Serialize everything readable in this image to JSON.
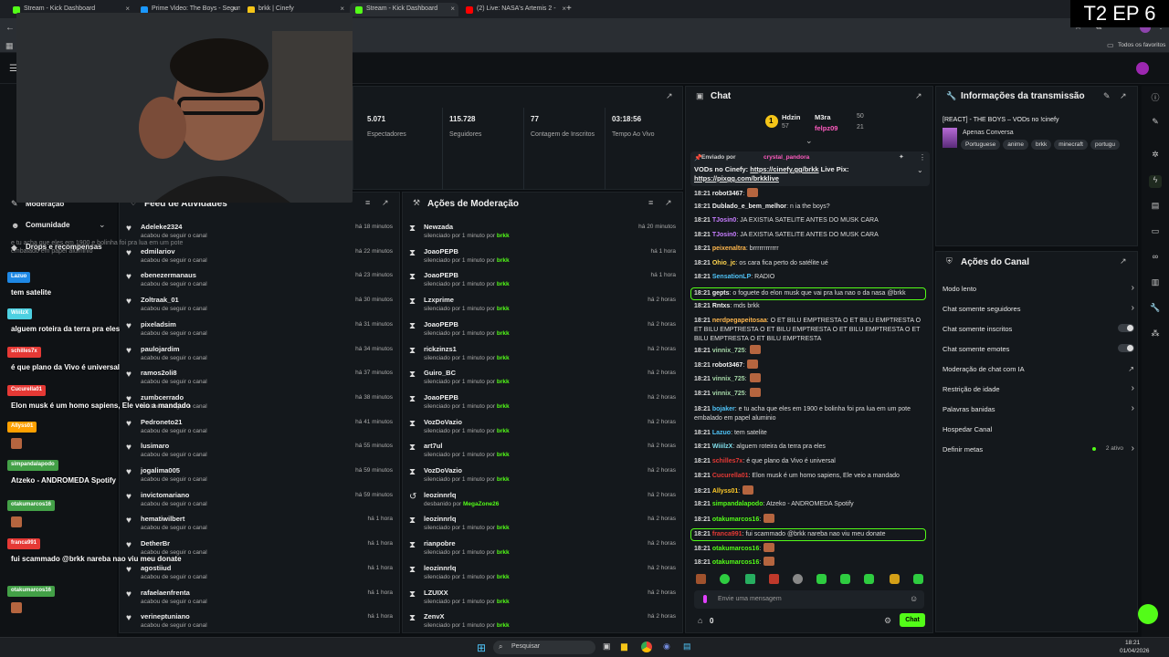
{
  "overlay_label": "T2 EP 6",
  "browser": {
    "tabs": [
      {
        "title": "Stream - Kick Dashboard",
        "color": "#53fc18"
      },
      {
        "title": "Prime Video: The Boys - Segun",
        "color": "#1a98ff"
      },
      {
        "title": "brkk | Cinefy",
        "color": "#f5c518"
      },
      {
        "title": "Stream - Kick Dashboard",
        "color": "#53fc18"
      },
      {
        "title": "(2) Live: NASA's Artemis 2 - ",
        "color": "#ff0000"
      }
    ],
    "new_tab": "+",
    "bookmarks_label": "Todos os favoritos"
  },
  "sidebar": {
    "moderation": "Moderação",
    "community": "Comunidade",
    "drops": "Drops e recompensas"
  },
  "stats": [
    {
      "value": "5.071",
      "label": "Espectadores"
    },
    {
      "value": "115.728",
      "label": "Seguidores"
    },
    {
      "value": "77",
      "label": "Contagem de Inscritos"
    },
    {
      "value": "03:18:56",
      "label": "Tempo Ao Vivo"
    }
  ],
  "feed": {
    "title": "Feed de Atividades",
    "items": [
      {
        "name": "Adeleke2324",
        "sub": "acabou de seguir o canal",
        "time": "há 18 minutos"
      },
      {
        "name": "edmilariov",
        "sub": "acabou de seguir o canal",
        "time": "há 22 minutos"
      },
      {
        "name": "ebenezermanaus",
        "sub": "acabou de seguir o canal",
        "time": "há 23 minutos"
      },
      {
        "name": "Zoltraak_01",
        "sub": "acabou de seguir o canal",
        "time": "há 30 minutos"
      },
      {
        "name": "pixeladsim",
        "sub": "acabou de seguir o canal",
        "time": "há 31 minutos"
      },
      {
        "name": "paulojardim",
        "sub": "acabou de seguir o canal",
        "time": "há 34 minutos"
      },
      {
        "name": "ramos2oli8",
        "sub": "acabou de seguir o canal",
        "time": "há 37 minutos"
      },
      {
        "name": "zumbcerrado",
        "sub": "acabou de seguir o canal",
        "time": "há 38 minutos"
      },
      {
        "name": "Pedroneto21",
        "sub": "acabou de seguir o canal",
        "time": "há 41 minutos"
      },
      {
        "name": "lusimaro",
        "sub": "acabou de seguir o canal",
        "time": "há 55 minutos"
      },
      {
        "name": "jogalima005",
        "sub": "acabou de seguir o canal",
        "time": "há 59 minutos"
      },
      {
        "name": "invictomariano",
        "sub": "acabou de seguir o canal",
        "time": "há 59 minutos"
      },
      {
        "name": "hematiwilbert",
        "sub": "acabou de seguir o canal",
        "time": "há 1 hora"
      },
      {
        "name": "DetherBr",
        "sub": "acabou de seguir o canal",
        "time": "há 1 hora"
      },
      {
        "name": "agostiiud",
        "sub": "acabou de seguir o canal",
        "time": "há 1 hora"
      },
      {
        "name": "rafaelaenfrenta",
        "sub": "acabou de seguir o canal",
        "time": "há 1 hora"
      },
      {
        "name": "verineptuniano",
        "sub": "acabou de seguir o canal",
        "time": "há 1 hora"
      }
    ]
  },
  "modactions": {
    "title": "Ações de Moderação",
    "by": "brkk",
    "items": [
      {
        "name": "Newzada",
        "sub": "silenciado por 1 minuto por",
        "by": "brkk",
        "time": "há 20 minutos",
        "icon": "⧗"
      },
      {
        "name": "JoaoPEPB",
        "sub": "silenciado por 1 minuto por",
        "by": "brkk",
        "time": "há 1 hora",
        "icon": "⧗"
      },
      {
        "name": "JoaoPEPB",
        "sub": "silenciado por 1 minuto por",
        "by": "brkk",
        "time": "há 1 hora",
        "icon": "⧗"
      },
      {
        "name": "Lzxprime",
        "sub": "silenciado por 1 minuto por",
        "by": "brkk",
        "time": "há 2 horas",
        "icon": "⧗"
      },
      {
        "name": "JoaoPEPB",
        "sub": "silenciado por 1 minuto por",
        "by": "brkk",
        "time": "há 2 horas",
        "icon": "⧗"
      },
      {
        "name": "rickzinzs1",
        "sub": "silenciado por 1 minuto por",
        "by": "brkk",
        "time": "há 2 horas",
        "icon": "⧗"
      },
      {
        "name": "Guiro_BC",
        "sub": "silenciado por 1 minuto por",
        "by": "brkk",
        "time": "há 2 horas",
        "icon": "⧗"
      },
      {
        "name": "JoaoPEPB",
        "sub": "silenciado por 1 minuto por",
        "by": "brkk",
        "time": "há 2 horas",
        "icon": "⧗"
      },
      {
        "name": "VozDoVazio",
        "sub": "silenciado por 1 minuto por",
        "by": "brkk",
        "time": "há 2 horas",
        "icon": "⧗"
      },
      {
        "name": "art7ul",
        "sub": "silenciado por 1 minuto por",
        "by": "brkk",
        "time": "há 2 horas",
        "icon": "⧗"
      },
      {
        "name": "VozDoVazio",
        "sub": "silenciado por 1 minuto por",
        "by": "brkk",
        "time": "há 2 horas",
        "icon": "⧗"
      },
      {
        "name": "leozinnrlq",
        "sub": "desbanido por",
        "by": "MegaZone26",
        "time": "há 2 horas",
        "icon": "↺"
      },
      {
        "name": "leozinnrlq",
        "sub": "silenciado por 1 minuto por",
        "by": "brkk",
        "time": "há 2 horas",
        "icon": "⧗"
      },
      {
        "name": "rianpobre",
        "sub": "silenciado por 1 minuto por",
        "by": "brkk",
        "time": "há 2 horas",
        "icon": "⧗"
      },
      {
        "name": "leozinnrlq",
        "sub": "silenciado por 1 minuto por",
        "by": "brkk",
        "time": "há 2 horas",
        "icon": "⧗"
      },
      {
        "name": "LZUIXX",
        "sub": "silenciado por 1 minuto por",
        "by": "brkk",
        "time": "há 2 horas",
        "icon": "⧗"
      },
      {
        "name": "ZenvX",
        "sub": "silenciado por 1 minuto por",
        "by": "brkk",
        "time": "há 2 horas",
        "icon": "⧗"
      }
    ]
  },
  "chat": {
    "title": "Chat",
    "leaderboard": [
      {
        "rank": "1",
        "name": "Hdzin",
        "score": "57"
      },
      {
        "rank": "",
        "name": "M3ra",
        "score": "50"
      },
      {
        "rank": "",
        "name": "felpz09",
        "score": "21"
      }
    ],
    "pinned": {
      "label": "Enviado por",
      "user": "crystal_pandora",
      "text": "VODs no Cinefy: ",
      "link1": "https://cinefy.gg/brkk",
      "mid": " Live Pix: ",
      "link2": "https://pixgg.com/brkklive"
    },
    "messages": [
      {
        "t": "18:21",
        "user": "robot3467",
        "color": "#f0f0f0",
        "text": ":"
      },
      {
        "t": "18:21",
        "user": "Dublado_e_bem_melhor",
        "color": "#f0f0f0",
        "text": ": n ia the boys?"
      },
      {
        "t": "18:21",
        "user": "TJosin0",
        "color": "#c77dff",
        "text": ": JA EXISTIA SATELITE ANTES DO MUSK CARA"
      },
      {
        "t": "18:21",
        "user": "TJosin0",
        "color": "#c77dff",
        "text": ": JA EXISTIA SATELITE ANTES DO MUSK CARA"
      },
      {
        "t": "18:21",
        "user": "peixenaltra",
        "color": "#ffb74d",
        "text": ": brrrrrrrrrrrr"
      },
      {
        "t": "18:21",
        "user": "Ohio_jc",
        "color": "#ffd54f",
        "text": ": os cara fica perto do satélite ué"
      },
      {
        "t": "18:21",
        "user": "SensationLP",
        "color": "#4fc3f7",
        "text": ": RADIO"
      },
      {
        "t": "18:21",
        "user": "gepts",
        "color": "#f0f0f0",
        "text": ": o foguete do elon musk que vai pra lua nao o da nasa @brkk"
      },
      {
        "t": "18:21",
        "user": "Rntxs",
        "color": "#f0f0f0",
        "text": ": mds brkk"
      },
      {
        "t": "18:21",
        "user": "nerdpegapeitosaa",
        "color": "#ffb74d",
        "text": ": O ET BILU EMPTRESTA O ET BILU EMPTRESTA O ET BILU EMPTRESTA O ET BILU EMPTRESTA O ET BILU EMPTRESTA O ET BILU EMPTRESTA O ET BILU EMPTRESTA"
      },
      {
        "t": "18:21",
        "user": "vinnix_725",
        "color": "#a5d6a7",
        "text": ":"
      },
      {
        "t": "18:21",
        "user": "robot3467",
        "color": "#f0f0f0",
        "text": ":"
      },
      {
        "t": "18:21",
        "user": "vinnix_725",
        "color": "#a5d6a7",
        "text": ":"
      },
      {
        "t": "18:21",
        "user": "vinnix_725",
        "color": "#a5d6a7",
        "text": ":"
      },
      {
        "t": "18:21",
        "user": "bojaker",
        "color": "#4fc3f7",
        "text": ": e tu acha que eles em 1900 e bolinha foi pra lua em um pote embalado em papel aluminio"
      },
      {
        "t": "18:21",
        "user": "Lazuo",
        "color": "#4fc3f7",
        "text": ": tem satelite"
      },
      {
        "t": "18:21",
        "user": "WiiilzX",
        "color": "#80deea",
        "text": ": alguem roteira da terra pra eles"
      },
      {
        "t": "18:21",
        "user": "schilles7x",
        "color": "#e53935",
        "text": ": é que plano da Vivo é universal"
      },
      {
        "t": "18:21",
        "user": "Cucurella01",
        "color": "#e53935",
        "text": ": Elon musk é um homo sapiens, Ele veio a mandado"
      },
      {
        "t": "18:21",
        "user": "Allyss01",
        "color": "#ffca28",
        "text": ":"
      },
      {
        "t": "18:21",
        "user": "simpandalapodo",
        "color": "#53fc18",
        "text": ": Atzeko - ANDROMEDA Spotify"
      },
      {
        "t": "18:21",
        "user": "otakumarcos16",
        "color": "#53fc18",
        "text": ":"
      },
      {
        "t": "18:21",
        "user": "franca991",
        "color": "#e53935",
        "text": ": fui scammado   @brkk nareba nao viu meu donate"
      },
      {
        "t": "18:21",
        "user": "otakumarcos16",
        "color": "#53fc18",
        "text": ":"
      },
      {
        "t": "18:21",
        "user": "otakumarcos16",
        "color": "#53fc18",
        "text": ":"
      }
    ],
    "input_placeholder": "Envie uma mensagem",
    "viewer_count": "0",
    "send_label": "Chat"
  },
  "info": {
    "title": "Informações da transmissão",
    "stream_title": "[REACT] - THE BOYS – VODs no !cinefy",
    "category": "Apenas Conversa",
    "tags": [
      "Portuguese",
      "anime",
      "brkk",
      "minecraft",
      "portugu"
    ]
  },
  "channel_actions": {
    "title": "Ações do Canal",
    "items": [
      {
        "label": "Modo lento",
        "kind": "chev"
      },
      {
        "label": "Chat somente seguidores",
        "kind": "chev"
      },
      {
        "label": "Chat somente inscritos",
        "kind": "toggle"
      },
      {
        "label": "Chat somente emotes",
        "kind": "toggle"
      },
      {
        "label": "Moderação de chat com IA",
        "kind": "ext"
      },
      {
        "label": "Restrição de idade",
        "kind": "chev"
      },
      {
        "label": "Palavras banidas",
        "kind": "chev"
      },
      {
        "label": "Hospedar Canal",
        "kind": "none"
      },
      {
        "label": "Definir metas",
        "kind": "chev",
        "badge": "2 ativo"
      }
    ]
  },
  "overlay_chat": [
    {
      "tag": "Lazuo",
      "tagcolor": "#1e88e5",
      "text": "tem satelite"
    },
    {
      "tag": "WiiilzX",
      "tagcolor": "#4dd0e1",
      "text": "alguem roteira da terra pra eles"
    },
    {
      "tag": "schilles7x",
      "tagcolor": "#e53935",
      "text": "é que plano da Vivo é universal"
    },
    {
      "tag": "Cucurella01",
      "tagcolor": "#e53935",
      "text": "Elon musk é um homo sapiens, Ele veio a mandado"
    },
    {
      "tag": "Allyss01",
      "tagcolor": "#ffa000",
      "text": ""
    },
    {
      "tag": "simpandalapodo",
      "tagcolor": "#43a047",
      "text": "Atzeko - ANDROMEDA Spotify"
    },
    {
      "tag": "otakumarcos16",
      "tagcolor": "#43a047",
      "text": ""
    },
    {
      "tag": "franca991",
      "tagcolor": "#e53935",
      "text": "fui scammado   @brkk nareba nao viu meu donate"
    },
    {
      "tag": "otakumarcos16",
      "tagcolor": "#43a047",
      "text": ""
    }
  ],
  "overlay_top_text": "e tu acha que eles em 1900 e bolinha foi pra lua em um pote embalado em papel aluminio",
  "taskbar": {
    "search": "Pesquisar",
    "time": "18:21",
    "date": "01/04/2026"
  }
}
